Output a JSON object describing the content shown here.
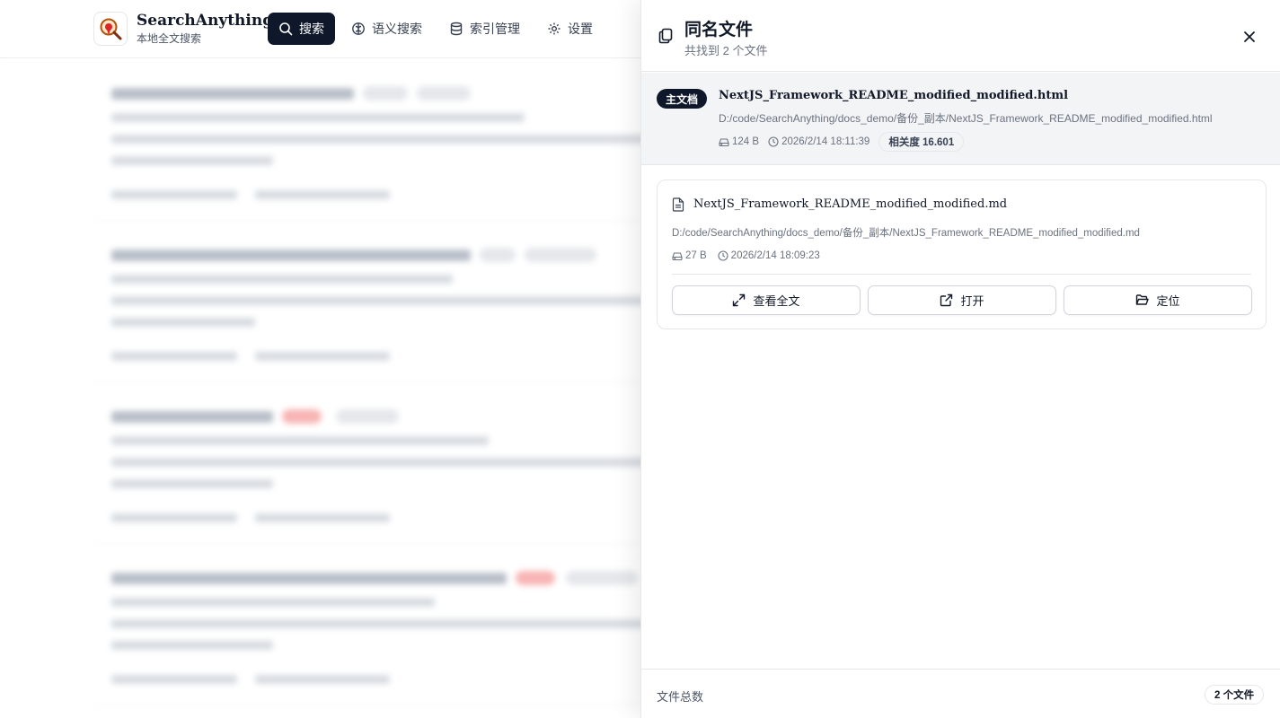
{
  "app": {
    "name": "SearchAnything",
    "subtitle": "本地全文搜索",
    "nav": [
      {
        "label": "搜索",
        "icon": "search-icon",
        "active": true
      },
      {
        "label": "语义搜索",
        "icon": "brain-icon",
        "active": false
      },
      {
        "label": "索引管理",
        "icon": "database-icon",
        "active": false
      },
      {
        "label": "设置",
        "icon": "gear-icon",
        "active": false
      }
    ]
  },
  "drawer": {
    "title": "同名文件",
    "subtitle": "共找到 2 个文件",
    "primary": {
      "badge": "主文档",
      "name": "NextJS_Framework_README_modified_modified.html",
      "path": "D:/code/SearchAnything/docs_demo/备份_副本/NextJS_Framework_README_modified_modified.html",
      "size": "124 B",
      "time": "2026/2/14 18:11:39",
      "score": "相关度 16.601"
    },
    "files": [
      {
        "name": "NextJS_Framework_README_modified_modified.md",
        "path": "D:/code/SearchAnything/docs_demo/备份_副本/NextJS_Framework_README_modified_modified.md",
        "size": "27 B",
        "time": "2026/2/14 18:09:23",
        "actions": {
          "view": "查看全文",
          "open": "打开",
          "locate": "定位"
        }
      }
    ],
    "footer": {
      "label": "文件总数",
      "count": "2 个文件"
    }
  },
  "colors": {
    "accent": "#0f172a",
    "border": "#e5e7eb",
    "muted": "#6b7280"
  }
}
